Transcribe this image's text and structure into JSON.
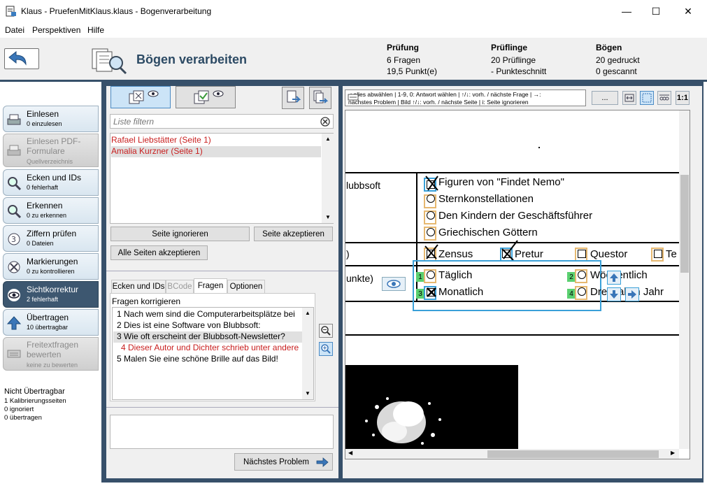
{
  "window": {
    "title": "Klaus - PruefenMitKlaus.klaus - Bogenverarbeitung",
    "minimize": "—",
    "maximize": "☐",
    "close": "✕"
  },
  "menu": [
    "Datei",
    "Perspektiven",
    "Hilfe"
  ],
  "header": {
    "title": "Bögen verarbeiten",
    "stats": [
      {
        "title": "Prüfung",
        "lines": [
          "6 Fragen",
          "19,5 Punkt(e)"
        ]
      },
      {
        "title": "Prüflinge",
        "lines": [
          "20 Prüflinge",
          "- Punkteschnitt"
        ]
      },
      {
        "title": "Bögen",
        "lines": [
          "20 gedruckt",
          "0 gescannt"
        ]
      }
    ]
  },
  "sidebar": {
    "items": [
      {
        "title": "Einlesen",
        "sub": "0 einzulesen",
        "state": "normal",
        "icon": "scanner-icon"
      },
      {
        "title": "Einlesen PDF-Formulare",
        "sub": "Quellverzeichnis",
        "state": "disabled",
        "icon": "scanner-icon"
      },
      {
        "title": "Ecken und IDs",
        "sub": "0 fehlerhaft",
        "state": "normal",
        "icon": "magnifier-icon"
      },
      {
        "title": "Erkennen",
        "sub": "0 zu erkennen",
        "state": "normal",
        "icon": "magnifier-icon"
      },
      {
        "title": "Ziffern prüfen",
        "sub": "0 Dateien",
        "state": "normal",
        "icon": "digit-icon"
      },
      {
        "title": "Markierungen",
        "sub": "0 zu kontrollieren",
        "state": "normal",
        "icon": "cross-mark-icon"
      },
      {
        "title": "Sichtkorrektur",
        "sub": "2 fehlerhaft",
        "state": "active",
        "icon": "eye-icon"
      },
      {
        "title": "Übertragen",
        "sub": "10 übertragbar",
        "state": "normal",
        "icon": "upload-arrow-icon"
      },
      {
        "title": "Freitextfragen bewerten",
        "sub": "keine zu bewerten",
        "state": "disabled",
        "icon": "keyboard-icon"
      }
    ],
    "not_transferable": {
      "title": "Nicht Übertragbar",
      "lines": [
        "1 Kalibrierungsseiten",
        "0 ignoriert",
        "0 übertragen"
      ]
    }
  },
  "left_panel": {
    "filter_placeholder": "Liste filtern",
    "students": [
      "Rafael Liebstätter (Seite 1)",
      "Amalia Kurzner (Seite 1)"
    ],
    "ignore_page": "Seite ignorieren",
    "accept_page": "Seite akzeptieren",
    "accept_all": "Alle Seiten akzeptieren",
    "tabs": [
      "Ecken und IDs",
      "BCode",
      "Fragen",
      "Optionen"
    ],
    "active_tab": "Fragen",
    "questions_label": "Fragen korrigieren",
    "questions": [
      {
        "text": "1 Nach wem sind die Computerarbeitsplätze bei",
        "color": "#000000"
      },
      {
        "text": "2 Dies ist eine Software von Blubbsoft:",
        "color": "#000000"
      },
      {
        "text": "3 Wie oft erscheint der Blubbsoft-Newsletter?",
        "color": "#000000",
        "selected": true
      },
      {
        "text": "4 Dieser Autor und Dichter schrieb unter andere",
        "color": "#c81e1e"
      },
      {
        "text": "5 Malen Sie eine schöne Brille auf das Bild!",
        "color": "#000000"
      }
    ],
    "next_problem": "Nächstes Problem"
  },
  "right_panel": {
    "key_help_line1": "-: alles abwählen | 1-9, 0: Antwort wählen | ↑/↓: vorh. / nächste Frage | →:",
    "key_help_line2": "nächstes Problem | Bild ↑/↓: vorh. / nächste Seite | i: Seite ignorieren",
    "dots_button": "...",
    "one_to_one": "1:1",
    "scan": {
      "left_labels": [
        "lubbsoft",
        ")",
        "unkte)"
      ],
      "q2_options": [
        "Figuren von \"Findet Nemo\"",
        "Sternkonstellationen",
        "Den Kindern der Geschäftsführer",
        "Griechischen Göttern"
      ],
      "q1_options": [
        "Zensus",
        "Pretur",
        "Questor",
        "Te"
      ],
      "q3_options": [
        "Täglich",
        "Wöchentlich",
        "Monatlich",
        "Dreimal im Jahr"
      ],
      "q3_numbers": [
        "1",
        "2",
        "3",
        "4"
      ]
    }
  }
}
